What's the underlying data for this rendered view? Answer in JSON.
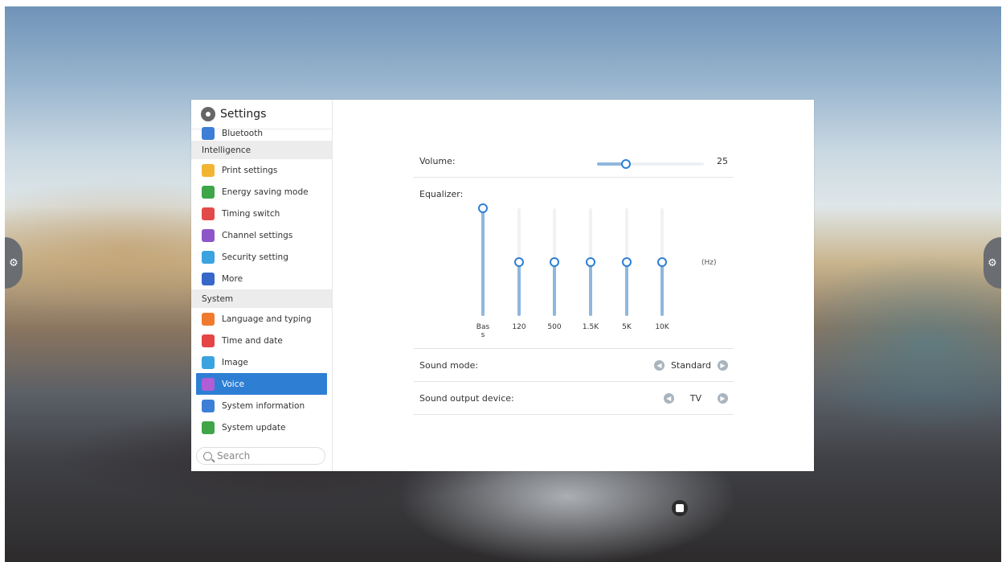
{
  "sidebar": {
    "title": "Settings",
    "partial_item": {
      "label": "Bluetooth",
      "icon": "bluetooth-icon",
      "color": "#3d7fd6"
    },
    "sections": [
      {
        "label": "Intelligence",
        "items": [
          {
            "label": "Print settings",
            "icon": "printer-icon",
            "color": "#f2b531"
          },
          {
            "label": "Energy saving mode",
            "icon": "leaf-icon",
            "color": "#3fa548"
          },
          {
            "label": "Timing switch",
            "icon": "clock-icon",
            "color": "#e24a4a"
          },
          {
            "label": "Channel settings",
            "icon": "monitor-icon",
            "color": "#8e55c8"
          },
          {
            "label": "Security setting",
            "icon": "shield-icon",
            "color": "#3ba3e0"
          },
          {
            "label": "More",
            "icon": "more-icon",
            "color": "#3767c8"
          }
        ]
      },
      {
        "label": "System",
        "items": [
          {
            "label": "Language and typing",
            "icon": "keyboard-icon",
            "color": "#f07a2e"
          },
          {
            "label": "Time and date",
            "icon": "calendar-icon",
            "color": "#e44545"
          },
          {
            "label": "Image",
            "icon": "image-icon",
            "color": "#3ba3e0"
          },
          {
            "label": "Voice",
            "icon": "speaker-icon",
            "color": "#b05ed6",
            "selected": true
          },
          {
            "label": "System information",
            "icon": "info-icon",
            "color": "#3d7fd6"
          },
          {
            "label": "System update",
            "icon": "update-arrow-icon",
            "color": "#3fa548"
          }
        ]
      }
    ],
    "search_placeholder": "Search"
  },
  "voice": {
    "volume_label": "Volume:",
    "volume_value": "25",
    "volume_level": 0.27,
    "equalizer_label": "Equalizer:",
    "equalizer_unit": "(Hz)",
    "bands": [
      {
        "label": "Bas\ns",
        "level": 1.0
      },
      {
        "label": "120",
        "level": 0.5
      },
      {
        "label": "500",
        "level": 0.5
      },
      {
        "label": "1.5K",
        "level": 0.5
      },
      {
        "label": "5K",
        "level": 0.5
      },
      {
        "label": "10K",
        "level": 0.5
      }
    ],
    "sound_mode_label": "Sound mode:",
    "sound_mode_value": "Standard",
    "output_device_label": "Sound output device:",
    "output_device_value": "TV"
  },
  "colors": {
    "accent": "#2e7fd4",
    "track": "#8fb7de"
  }
}
